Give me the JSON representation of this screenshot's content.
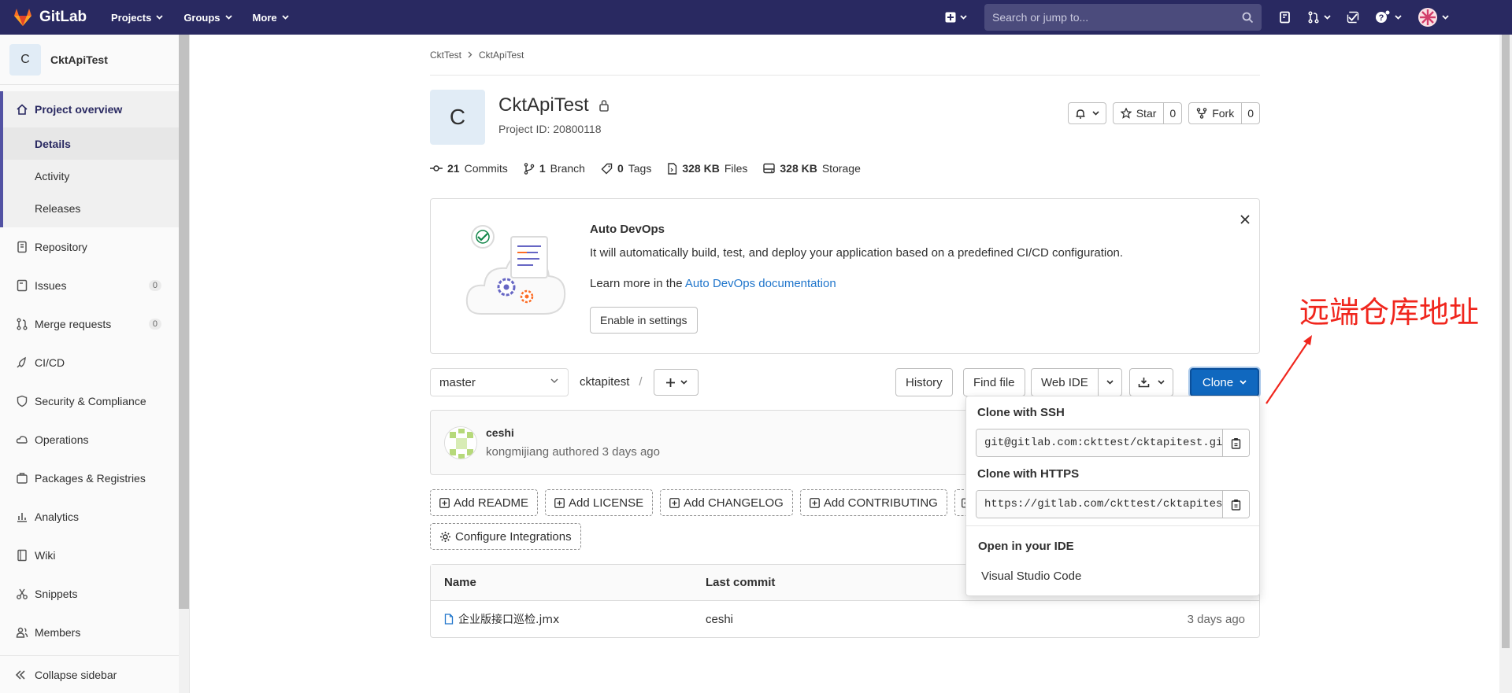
{
  "brand": {
    "name": "GitLab",
    "accent": "#292961",
    "primary_button": "#1068bf"
  },
  "topnav": {
    "items": [
      "Projects",
      "Groups",
      "More"
    ],
    "search_placeholder": "Search or jump to..."
  },
  "sidebar": {
    "project_initial": "C",
    "project_name": "CktApiTest",
    "overview": {
      "label": "Project overview",
      "subitems": [
        "Details",
        "Activity",
        "Releases"
      ]
    },
    "items": [
      {
        "label": "Repository",
        "icon": "repository-icon"
      },
      {
        "label": "Issues",
        "icon": "issues-icon",
        "count": "0"
      },
      {
        "label": "Merge requests",
        "icon": "merge-request-icon",
        "count": "0"
      },
      {
        "label": "CI/CD",
        "icon": "rocket-icon"
      },
      {
        "label": "Security & Compliance",
        "icon": "shield-icon"
      },
      {
        "label": "Operations",
        "icon": "cloud-gear-icon"
      },
      {
        "label": "Packages & Registries",
        "icon": "package-icon"
      },
      {
        "label": "Analytics",
        "icon": "chart-icon"
      },
      {
        "label": "Wiki",
        "icon": "book-icon"
      },
      {
        "label": "Snippets",
        "icon": "scissors-icon"
      },
      {
        "label": "Members",
        "icon": "users-icon"
      }
    ],
    "collapse_label": "Collapse sidebar"
  },
  "breadcrumb": [
    "CktTest",
    "CktApiTest"
  ],
  "project": {
    "initial": "C",
    "title": "CktApiTest",
    "id_text": "Project ID: 20800118",
    "star_label": "Star",
    "star_count": "0",
    "fork_label": "Fork",
    "fork_count": "0"
  },
  "stats": [
    {
      "value": "21",
      "label": "Commits",
      "icon": "commit-icon"
    },
    {
      "value": "1",
      "label": "Branch",
      "icon": "branch-icon"
    },
    {
      "value": "0",
      "label": "Tags",
      "icon": "tag-icon"
    },
    {
      "value": "328 KB",
      "label": "Files",
      "icon": "file-icon"
    },
    {
      "value": "328 KB",
      "label": "Storage",
      "icon": "storage-icon"
    }
  ],
  "autodevops": {
    "title": "Auto DevOps",
    "description": "It will automatically build, test, and deploy your application based on a predefined CI/CD configuration.",
    "learn_prefix": "Learn more in the ",
    "learn_link": "Auto DevOps documentation",
    "button": "Enable in settings"
  },
  "repo": {
    "branch": "master",
    "path_root": "cktapitest",
    "path_sep": "/",
    "history": "History",
    "find_file": "Find file",
    "web_ide": "Web IDE",
    "clone": "Clone"
  },
  "last_commit": {
    "title": "ceshi",
    "author": "kongmijiang",
    "meta_suffix": "authored 3 days ago"
  },
  "quick_actions": [
    "Add README",
    "Add LICENSE",
    "Add CHANGELOG",
    "Add CONTRIBUTING",
    "",
    "Configure Integrations"
  ],
  "files": {
    "headers": [
      "Name",
      "Last commit",
      ""
    ],
    "rows": [
      {
        "name": "企业版接口巡检.jmx",
        "commit": "ceshi",
        "date": "3 days ago"
      }
    ]
  },
  "clone_menu": {
    "ssh_label": "Clone with SSH",
    "ssh_url": "git@gitlab.com:ckttest/cktapitest.git",
    "https_label": "Clone with HTTPS",
    "https_url": "https://gitlab.com/ckttest/cktapitest.git",
    "ide_heading": "Open in your IDE",
    "ide_item": "Visual Studio Code"
  },
  "annotation": {
    "text": "远端仓库地址",
    "color": "#f0261d"
  }
}
